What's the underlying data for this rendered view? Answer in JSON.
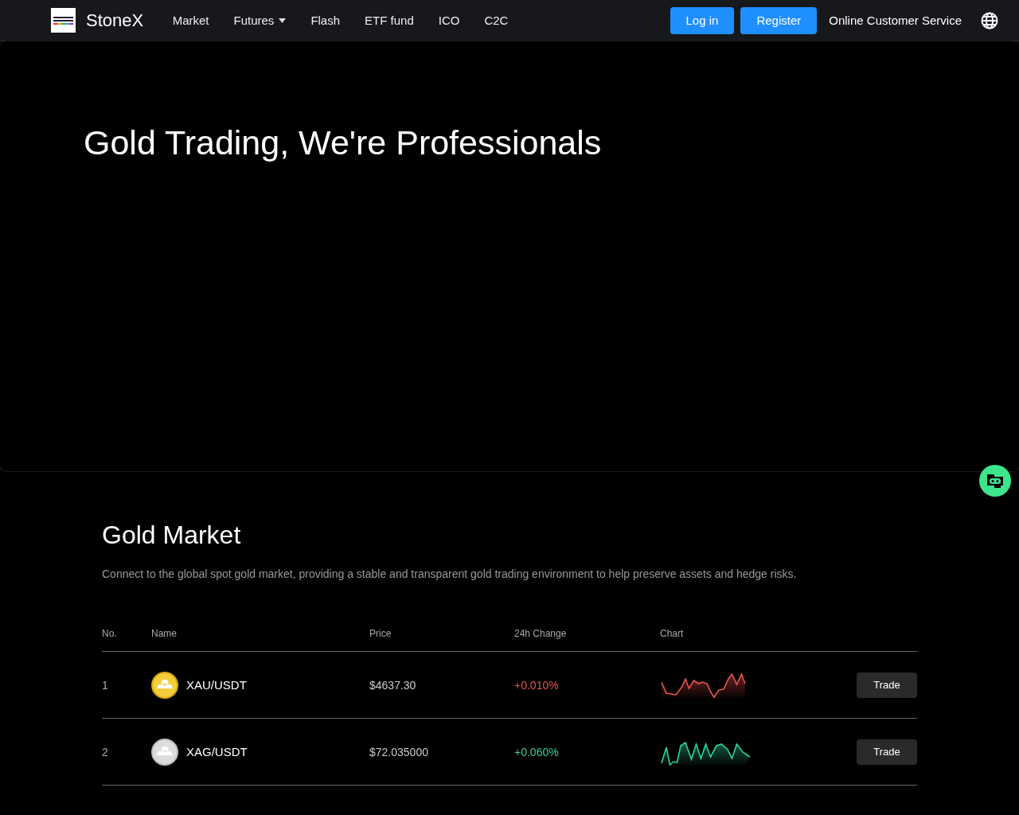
{
  "header": {
    "brand": "StoneX",
    "nav": [
      {
        "label": "Market",
        "dropdown": false
      },
      {
        "label": "Futures",
        "dropdown": true
      },
      {
        "label": "Flash",
        "dropdown": false
      },
      {
        "label": "ETF fund",
        "dropdown": false
      },
      {
        "label": "ICO",
        "dropdown": false
      },
      {
        "label": "C2C",
        "dropdown": false
      }
    ],
    "buttons": [
      "Log in",
      "Register"
    ],
    "service": "Online Customer Service"
  },
  "hero": {
    "title": "Gold Trading, We're Professionals"
  },
  "market": {
    "title": "Gold Market",
    "description": "Connect to the global spot gold market, providing a stable and transparent gold trading environment to help preserve assets and hedge risks.",
    "columns": [
      "No.",
      "Name",
      "Price",
      "24h Change",
      "Chart"
    ],
    "rows": [
      {
        "no": "1",
        "name": "XAU/USDT",
        "price": "$4637.30",
        "change": "+0.010%",
        "color": "#e8534f",
        "kind": "gold",
        "action": "Trade"
      },
      {
        "no": "2",
        "name": "XAG/USDT",
        "price": "$72.035000",
        "change": "+0.060%",
        "color": "#2fd39a",
        "kind": "silver",
        "action": "Trade"
      }
    ]
  }
}
